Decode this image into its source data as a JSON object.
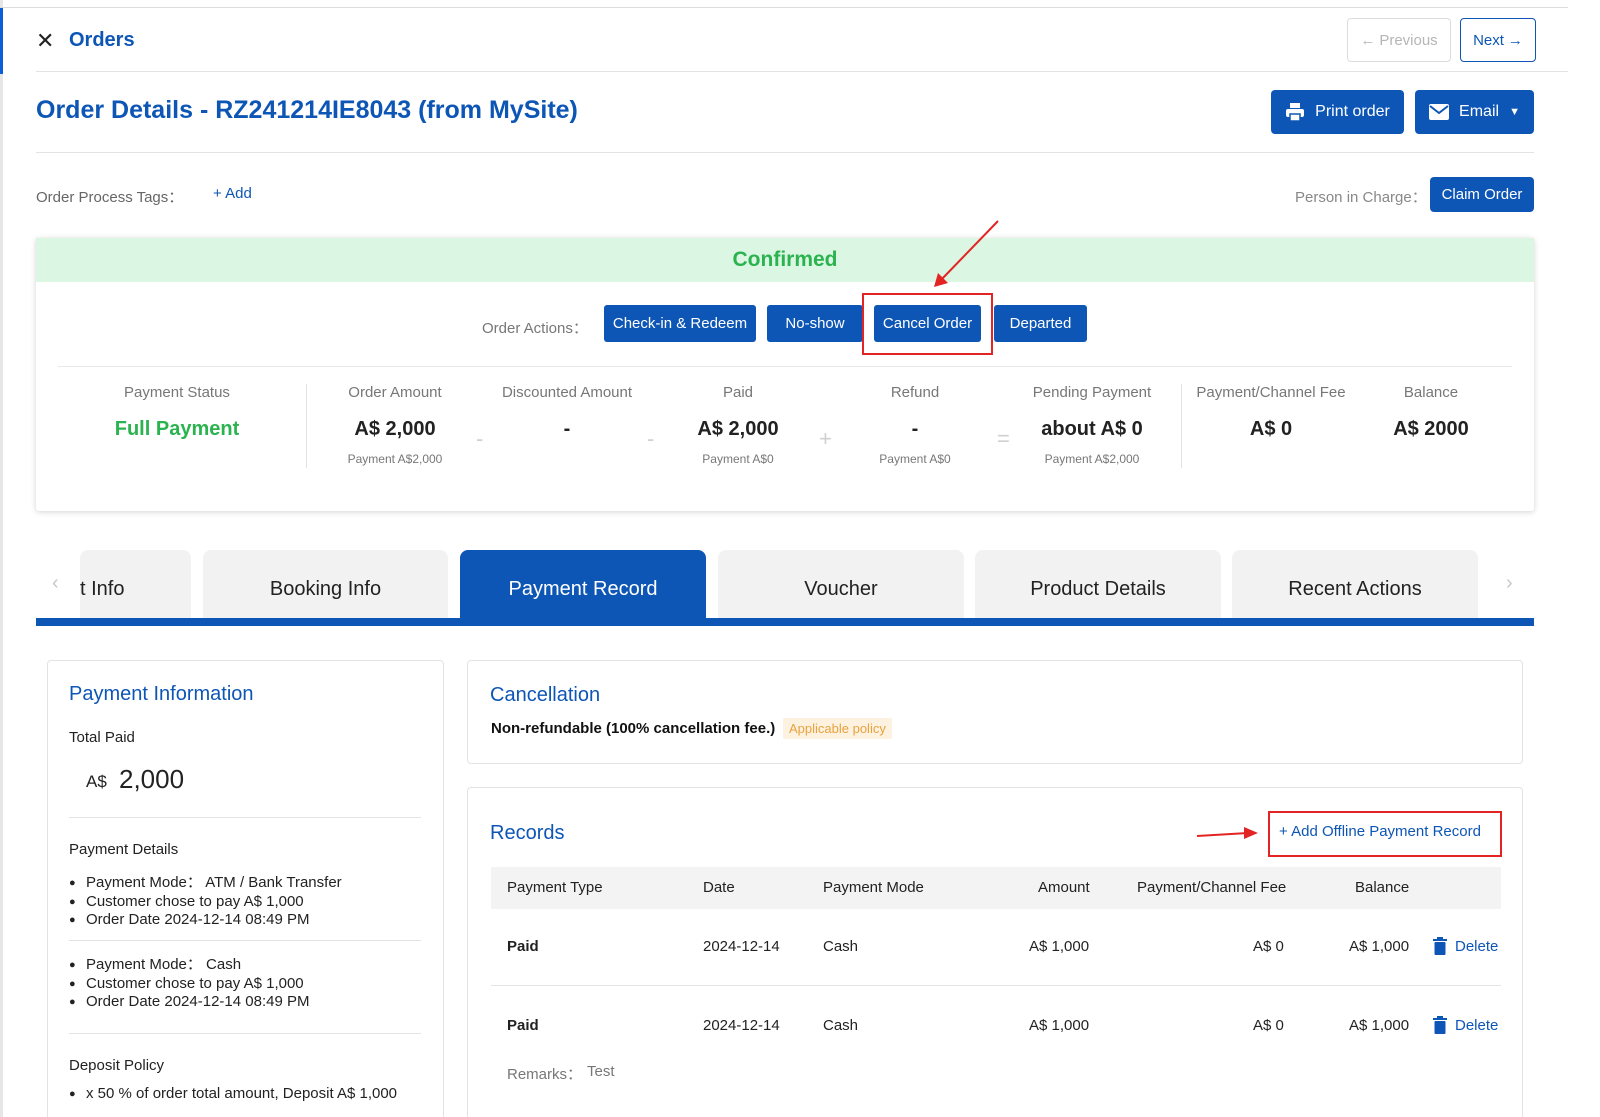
{
  "header": {
    "title": "Orders",
    "prev_label": "Previous",
    "next_label": "Next"
  },
  "page": {
    "title": "Order Details  - RZ241214IE8043 (from MySite)",
    "print_label": "Print order",
    "email_label": "Email"
  },
  "tags": {
    "label": "Order Process Tags：",
    "add_label": "+ Add",
    "person_label": "Person in Charge：",
    "claim_label": "Claim Order"
  },
  "status": {
    "text": "Confirmed",
    "actions_label": "Order Actions：",
    "actions": [
      "Check-in & Redeem",
      "No-show",
      "Cancel Order",
      "Departed"
    ]
  },
  "metrics": [
    {
      "label": "Payment Status",
      "value": "Full Payment",
      "sub": ""
    },
    {
      "label": "Order Amount",
      "value": "A$ 2,000",
      "sub": "Payment A$2,000"
    },
    {
      "label": "Discounted Amount",
      "value": "-",
      "sub": ""
    },
    {
      "label": "Paid",
      "value": "A$ 2,000",
      "sub": "Payment A$0"
    },
    {
      "label": "Refund",
      "value": "-",
      "sub": "Payment A$0"
    },
    {
      "label": "Pending Payment",
      "value": "about A$ 0",
      "sub": "Payment A$2,000"
    },
    {
      "label": "Payment/Channel Fee",
      "value": "A$ 0",
      "sub": ""
    },
    {
      "label": "Balance",
      "value": "A$ 2000",
      "sub": ""
    }
  ],
  "operators": [
    "-",
    "-",
    "+",
    "=",
    "="
  ],
  "tabs": [
    "t Info",
    "Booking Info",
    "Payment Record",
    "Voucher",
    "Product Details",
    "Recent Actions"
  ],
  "payment_info": {
    "title": "Payment Information",
    "total_label": "Total Paid",
    "currency": "A$",
    "total": "2,000",
    "details_label": "Payment Details",
    "groups": [
      [
        "Payment Mode： ATM / Bank Transfer",
        "Customer chose to pay A$ 1,000",
        "Order Date 2024-12-14 08:49 PM"
      ],
      [
        "Payment Mode： Cash",
        "Customer chose to pay A$ 1,000",
        "Order Date 2024-12-14 08:49 PM"
      ]
    ],
    "deposit_label": "Deposit Policy",
    "deposit_item": "x 50 % of order total amount, Deposit A$ 1,000"
  },
  "cancellation": {
    "title": "Cancellation",
    "text": "Non-refundable (100% cancellation fee.)",
    "badge": "Applicable policy"
  },
  "records": {
    "title": "Records",
    "add_label": "+ Add Offline Payment Record",
    "columns": [
      "Payment Type",
      "Date",
      "Payment Mode",
      "Amount",
      "Payment/Channel Fee",
      "Balance"
    ],
    "rows": [
      {
        "type": "Paid",
        "date": "2024-12-14",
        "mode": "Cash",
        "amount": "A$ 1,000",
        "fee": "A$ 0",
        "balance": "A$ 1,000",
        "action": "Delete"
      },
      {
        "type": "Paid",
        "date": "2024-12-14",
        "mode": "Cash",
        "amount": "A$ 1,000",
        "fee": "A$ 0",
        "balance": "A$ 1,000",
        "action": "Delete"
      }
    ],
    "remarks_label": "Remarks：",
    "remarks_value": "Test"
  },
  "colors": {
    "primary": "#0d56b5",
    "success": "#2bb34f",
    "annotation": "#e32424"
  }
}
